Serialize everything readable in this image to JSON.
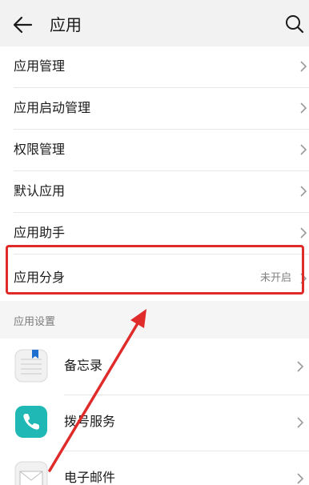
{
  "header": {
    "title": "应用"
  },
  "menu": {
    "items": [
      {
        "label": "应用管理"
      },
      {
        "label": "应用启动管理"
      },
      {
        "label": "权限管理"
      },
      {
        "label": "默认应用"
      },
      {
        "label": "应用助手"
      },
      {
        "label": "应用分身",
        "status": "未开启"
      }
    ]
  },
  "section": {
    "title": "应用设置"
  },
  "apps": [
    {
      "name": "备忘录",
      "icon": "memo-icon"
    },
    {
      "name": "拨号服务",
      "icon": "phone-icon"
    },
    {
      "name": "电子邮件",
      "icon": "mail-icon"
    }
  ],
  "colors": {
    "highlight": "#e02b2b",
    "phone_app": "#1fb8b4",
    "memo_bookmark": "#1f6fd1"
  }
}
